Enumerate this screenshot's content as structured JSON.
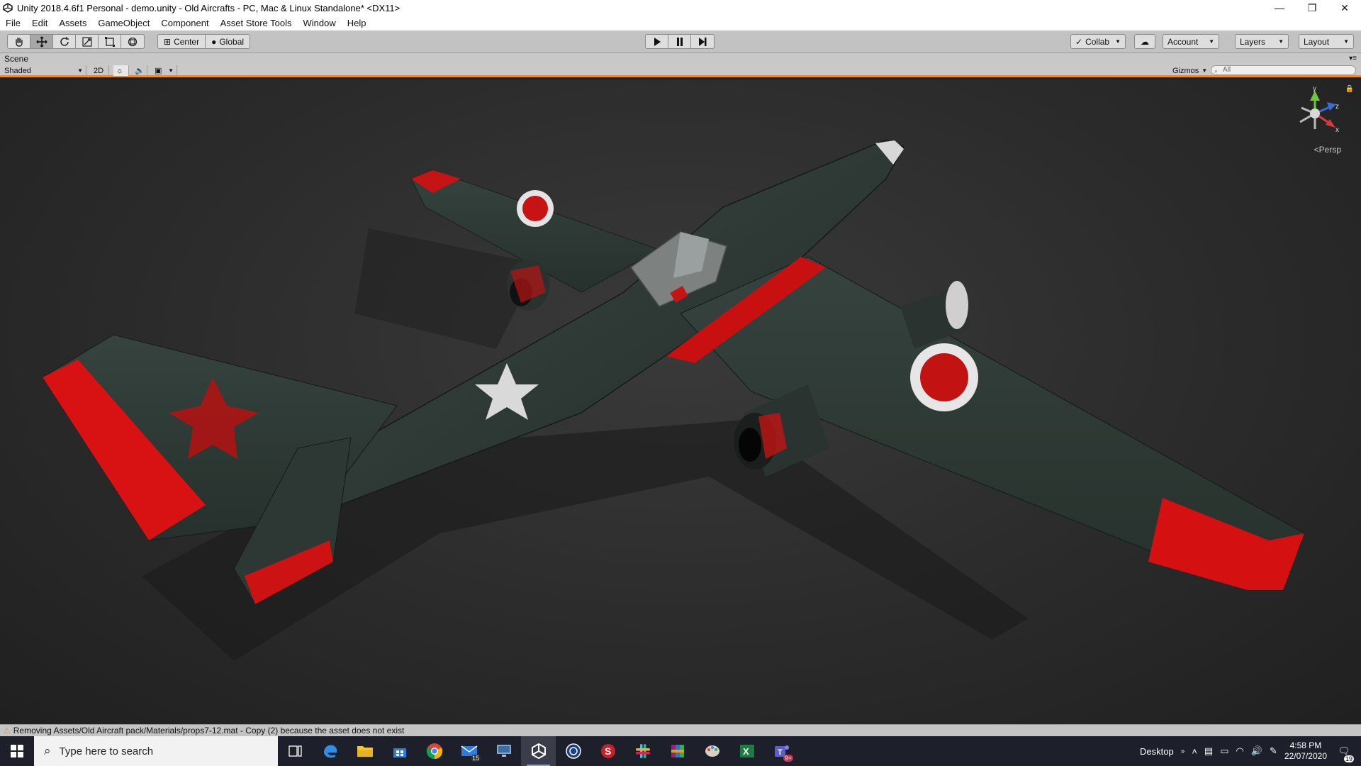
{
  "window": {
    "title": "Unity 2018.4.6f1 Personal - demo.unity - Old Aircrafts - PC, Mac & Linux Standalone* <DX11>",
    "minimize_glyph": "—",
    "maximize_glyph": "❐",
    "close_glyph": "✕"
  },
  "menu": [
    "File",
    "Edit",
    "Assets",
    "GameObject",
    "Component",
    "Asset Store Tools",
    "Window",
    "Help"
  ],
  "toolbar": {
    "tools": [
      "hand-tool",
      "move-tool",
      "rotate-tool",
      "scale-tool",
      "rect-tool",
      "transform-tool"
    ],
    "pivot_mode": "Center",
    "pivot_rotation": "Global",
    "play_controls": [
      "play",
      "pause",
      "step"
    ],
    "collab_label": "Collab",
    "account_label": "Account",
    "layers_label": "Layers",
    "layout_label": "Layout"
  },
  "scene": {
    "tab_label": "Scene",
    "shading_mode": "Shaded",
    "toggle_2d": "2D",
    "gizmos_label": "Gizmos",
    "search_placeholder": "All",
    "persp_label": "Persp",
    "axis_x": "x",
    "axis_y": "y",
    "axis_z": "z"
  },
  "status": {
    "message": "Removing Assets/Old Aircraft pack/Materials/props7-12.mat - Copy (2) because the asset does not exist"
  },
  "taskbar": {
    "search_placeholder": "Type here to search",
    "apps": [
      {
        "name": "task-view",
        "badge": ""
      },
      {
        "name": "edge",
        "badge": ""
      },
      {
        "name": "file-explorer",
        "badge": ""
      },
      {
        "name": "store",
        "badge": ""
      },
      {
        "name": "chrome",
        "badge": ""
      },
      {
        "name": "mail",
        "badge": "15"
      },
      {
        "name": "remote-desktop",
        "badge": ""
      },
      {
        "name": "unity",
        "badge": ""
      },
      {
        "name": "cinema4d",
        "badge": ""
      },
      {
        "name": "substance",
        "badge": ""
      },
      {
        "name": "slack",
        "badge": ""
      },
      {
        "name": "winrar",
        "badge": ""
      },
      {
        "name": "paint",
        "badge": ""
      },
      {
        "name": "excel",
        "badge": ""
      },
      {
        "name": "teams",
        "badge": "9+"
      }
    ],
    "desktop_label": "Desktop",
    "time": "4:58 PM",
    "date": "22/07/2020",
    "notifications": "19"
  },
  "colors": {
    "accent_orange": "#f08a24",
    "aircraft_body": "#2f3a36",
    "aircraft_red": "#d41010"
  }
}
